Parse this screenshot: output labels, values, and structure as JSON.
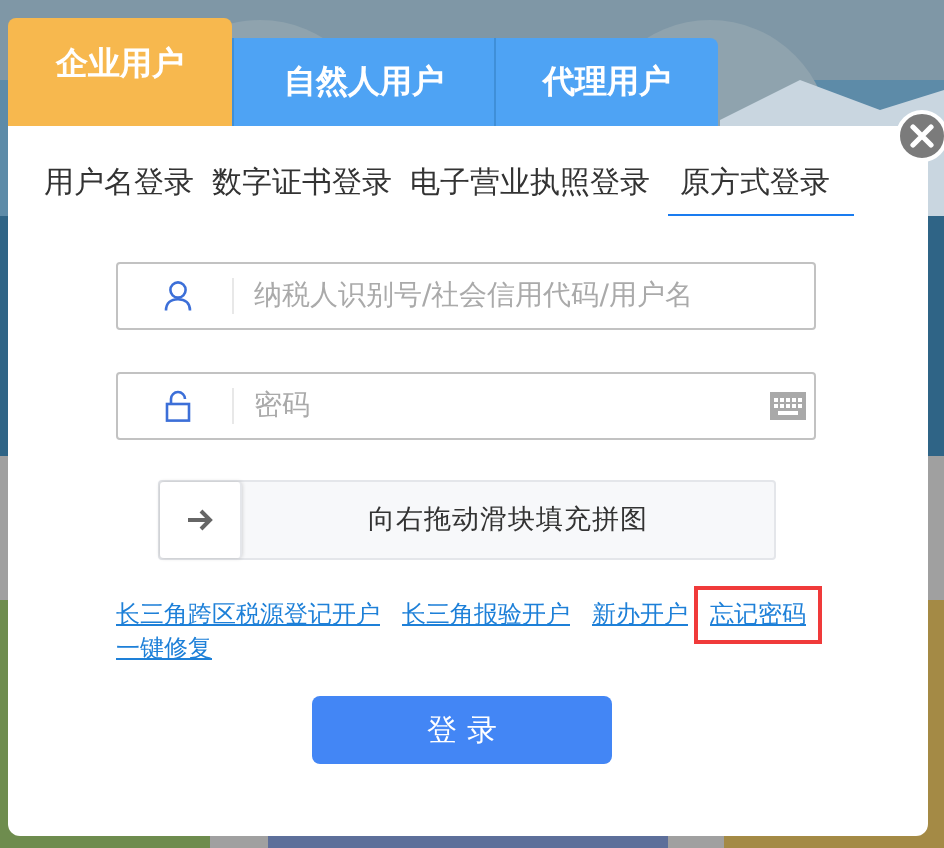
{
  "user_tabs": [
    {
      "label": "企业用户",
      "selected": true
    },
    {
      "label": "自然人用户",
      "selected": false
    },
    {
      "label": "代理用户",
      "selected": false
    }
  ],
  "login_methods": [
    {
      "label": "用户名登录",
      "selected": false
    },
    {
      "label": "数字证书登录",
      "selected": false
    },
    {
      "label": "电子营业执照登录",
      "selected": false
    },
    {
      "label": "原方式登录",
      "selected": true
    }
  ],
  "username_field": {
    "placeholder": "纳税人识别号/社会信用代码/用户名"
  },
  "password_field": {
    "placeholder": "密码"
  },
  "slider": {
    "label": "向右拖动滑块填充拼图",
    "level": 0
  },
  "links": [
    {
      "label": "长三角跨区税源登记开户",
      "highlighted": false
    },
    {
      "label": "长三角报验开户",
      "highlighted": false
    },
    {
      "label": "新办开户",
      "highlighted": false
    },
    {
      "label": "忘记密码",
      "highlighted": true
    },
    {
      "label": "一键修复",
      "highlighted": false
    }
  ],
  "login_button": {
    "label": "登 录"
  }
}
